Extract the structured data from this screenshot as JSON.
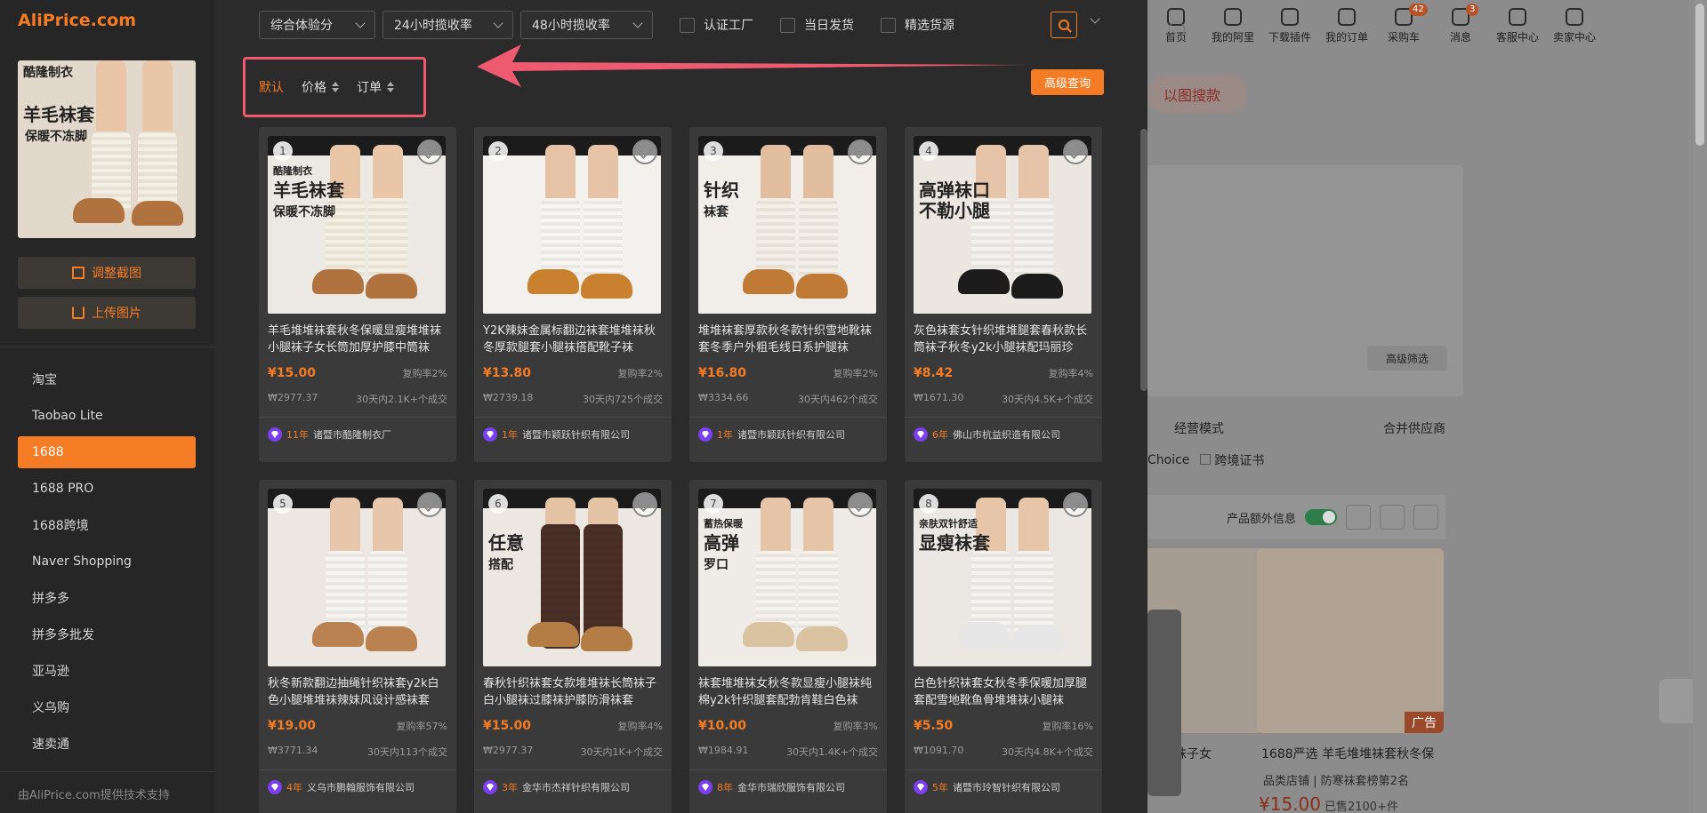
{
  "colors": {
    "accent": "#f47c25",
    "highlight_box": "#ee5a6f",
    "badge_purple": "#7b3ff2"
  },
  "sidebar": {
    "logo": "AliPrice.com",
    "query_image": {
      "brand": "酷隆制衣",
      "line1": "羊毛袜套",
      "line2": "保暖不冻脚"
    },
    "adjust_crop": "调整截图",
    "upload_image": "上传图片",
    "platforms": [
      "淘宝",
      "Taobao Lite",
      "1688",
      "1688 PRO",
      "1688跨境",
      "Naver Shopping",
      "拼多多",
      "拼多多批发",
      "亚马逊",
      "义乌购",
      "速卖通"
    ],
    "active_platform": "1688",
    "credit": "由AliPrice.com提供技术支持"
  },
  "toolbar": {
    "select1": "综合体验分",
    "select2": "24小时揽收率",
    "select3": "48小时揽收率",
    "check1": "认证工厂",
    "check2": "当日发货",
    "check3": "精选货源"
  },
  "sort": {
    "default": "默认",
    "price": "价格",
    "orders": "订单",
    "advanced": "高级查询"
  },
  "products": [
    {
      "idx": "1",
      "title": "羊毛堆堆袜套秋冬保暖显瘦堆堆袜小腿袜子女长筒加厚护膝中筒袜",
      "price": "¥15.00",
      "repurchase": "复购率2%",
      "sales_total": "₩2977.37",
      "sales_30d": "30天内2.1K+个成交",
      "years": "11年",
      "supplier": "诸暨市酷隆制衣厂",
      "art": {
        "bg": "#ece8e3",
        "warmer": "#f4efe2",
        "leg": "#e9c6a8",
        "boot": "#b0723f",
        "text": "羊毛袜套",
        "text2": "保暖不冻脚",
        "brand": "酷隆制衣"
      }
    },
    {
      "idx": "2",
      "title": "Y2K辣妹金属标翻边袜套堆堆袜秋冬厚款腿套小腿袜搭配靴子袜",
      "price": "¥13.80",
      "repurchase": "复购率2%",
      "sales_total": "₩2739.18",
      "sales_30d": "30天内725个成交",
      "years": "1年",
      "supplier": "诸暨市颖跃针织有限公司",
      "art": {
        "bg": "#f3f1ee",
        "warmer": "#f8f6f2",
        "leg": "#e6c3a6",
        "boot": "#c9812f",
        "text": "",
        "text2": "",
        "brand": ""
      }
    },
    {
      "idx": "3",
      "title": "堆堆袜套厚款秋冬款针织雪地靴袜套冬季户外粗毛线日系护腿袜",
      "price": "¥16.80",
      "repurchase": "复购率2%",
      "sales_total": "₩3334.66",
      "sales_30d": "30天内462个成交",
      "years": "1年",
      "supplier": "诸暨市颖跃针织有限公司",
      "art": {
        "bg": "#f1eeea",
        "warmer": "#f3efe6",
        "leg": "#e2bea0",
        "boot": "#c07a35",
        "text": "针织",
        "text2": "袜套",
        "brand": ""
      }
    },
    {
      "idx": "4",
      "title": "灰色袜套女针织堆堆腿套春秋款长筒袜子秋冬y2k小腿袜配玛丽珍",
      "price": "¥8.42",
      "repurchase": "复购率4%",
      "sales_total": "₩1671.30",
      "sales_30d": "30天内4.5K+个成交",
      "years": "6年",
      "supplier": "佛山市杭益织造有限公司",
      "art": {
        "bg": "#ebe6e0",
        "warmer": "#f4f2ee",
        "leg": "#e5c4aa",
        "boot": "#1c1c1c",
        "text": "高弹袜口 不勒小腿",
        "text2": "",
        "brand": ""
      }
    },
    {
      "idx": "5",
      "title": "秋冬新款翻边抽绳针织袜套y2k白色小腿堆堆袜辣妹风设计感袜套",
      "price": "¥19.00",
      "repurchase": "复购率57%",
      "sales_total": "₩3771.34",
      "sales_30d": "30天内113个成交",
      "years": "4年",
      "supplier": "义乌市鹏翰服饰有限公司",
      "art": {
        "bg": "#ece7e2",
        "warmer": "#f7f5f1",
        "leg": "#e7c6ab",
        "boot": "#b98250",
        "text": "",
        "text2": "",
        "brand": ""
      }
    },
    {
      "idx": "6",
      "title": "春秋针织袜套女款堆堆袜长筒袜子白小腿袜过膝袜护膝防滑袜套",
      "price": "¥15.00",
      "repurchase": "复购率4%",
      "sales_total": "₩2977.37",
      "sales_30d": "30天内1K+个成交",
      "years": "3年",
      "supplier": "金华市杰祥针织有限公司",
      "art": {
        "bg": "#ece7e1",
        "warmer": "#4a3027",
        "leg": "#e4c2a4",
        "boot": "#b57d46",
        "text": "任意",
        "text2": "搭配",
        "brand": ""
      }
    },
    {
      "idx": "7",
      "title": "袜套堆堆袜女秋冬款显瘦小腿袜纯棉y2k针织腿套配勃肯鞋白色袜",
      "price": "¥10.00",
      "repurchase": "复购率3%",
      "sales_total": "₩1984.91",
      "sales_30d": "30天内1.4K+个成交",
      "years": "8年",
      "supplier": "金华市瑞欣服饰有限公司",
      "art": {
        "bg": "#efebe6",
        "warmer": "#f6f3ee",
        "leg": "#e6c4a8",
        "boot": "#d9c3a0",
        "text": "高弹",
        "text2": "罗口",
        "brand": "蓄热保暖"
      }
    },
    {
      "idx": "8",
      "title": "白色针织袜套女秋冬季保暖加厚腿套配雪地靴鱼骨堆堆袜小腿袜",
      "price": "¥5.50",
      "repurchase": "复购率16%",
      "sales_total": "₩1091.70",
      "sales_30d": "30天内4.8K+个成交",
      "years": "5年",
      "supplier": "诸暨市玲智针织有限公司",
      "art": {
        "bg": "#ebe7e2",
        "warmer": "#f5f3ef",
        "leg": "#e7c5a9",
        "boot": "#e6e6e6",
        "text": "显瘦袜套",
        "text2": "",
        "brand": "亲肤双针舒适"
      }
    }
  ],
  "background_page": {
    "nav": [
      "首页",
      "我的阿里",
      "下载插件",
      "我的订单",
      "采购车",
      "消息",
      "客服中心",
      "卖家中心"
    ],
    "cart_count": "42",
    "msg_count": "3",
    "image_search": "以图搜款",
    "advanced_filter": "高级筛选",
    "business_mode": "经营模式",
    "merge_supplier": "合并供应商",
    "choice": "Choice",
    "cross_border_cert": "跨境证书",
    "extra_info": "产品额外信息",
    "ad_label": "广告",
    "card_text_1": "袜子女",
    "card_text_2": "1688严选 羊毛堆堆袜套秋冬保",
    "store_type": "品类店铺",
    "rank": "防寒袜套榜第2名",
    "price": "¥15.00",
    "sold": "已售2100+件"
  }
}
